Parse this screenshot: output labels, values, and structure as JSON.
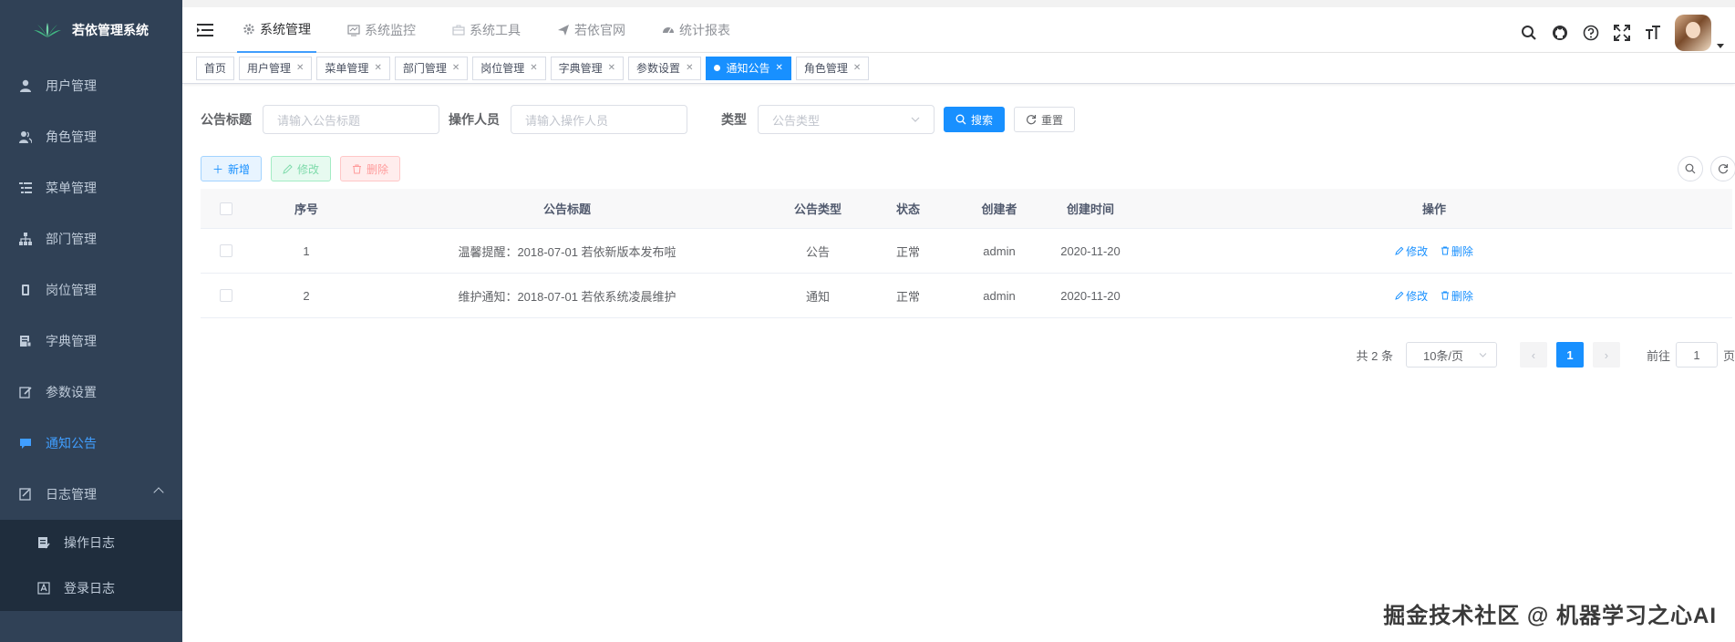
{
  "sidebar": {
    "logo_text": "若依管理系统",
    "items": [
      {
        "label": "用户管理"
      },
      {
        "label": "角色管理"
      },
      {
        "label": "菜单管理"
      },
      {
        "label": "部门管理"
      },
      {
        "label": "岗位管理"
      },
      {
        "label": "字典管理"
      },
      {
        "label": "参数设置"
      },
      {
        "label": "通知公告"
      },
      {
        "label": "日志管理"
      }
    ],
    "sub_items": [
      {
        "label": "操作日志"
      },
      {
        "label": "登录日志"
      }
    ]
  },
  "topnav": [
    {
      "label": "系统管理"
    },
    {
      "label": "系统监控"
    },
    {
      "label": "系统工具"
    },
    {
      "label": "若依官网"
    },
    {
      "label": "统计报表"
    }
  ],
  "tags": [
    {
      "label": "首页"
    },
    {
      "label": "用户管理"
    },
    {
      "label": "菜单管理"
    },
    {
      "label": "部门管理"
    },
    {
      "label": "岗位管理"
    },
    {
      "label": "字典管理"
    },
    {
      "label": "参数设置"
    },
    {
      "label": "通知公告"
    },
    {
      "label": "角色管理"
    }
  ],
  "search": {
    "title_label": "公告标题",
    "title_placeholder": "请输入公告标题",
    "operator_label": "操作人员",
    "operator_placeholder": "请输入操作人员",
    "type_label": "类型",
    "type_placeholder": "公告类型",
    "search_btn": "搜索",
    "reset_btn": "重置"
  },
  "toolbar": {
    "add": "新增",
    "edit": "修改",
    "delete": "删除"
  },
  "table": {
    "headers": [
      "序号",
      "公告标题",
      "公告类型",
      "状态",
      "创建者",
      "创建时间",
      "操作"
    ],
    "rows": [
      {
        "id": "1",
        "title": "温馨提醒：2018-07-01 若依新版本发布啦",
        "type": "公告",
        "status": "正常",
        "creator": "admin",
        "created": "2020-11-20"
      },
      {
        "id": "2",
        "title": "维护通知：2018-07-01 若依系统凌晨维护",
        "type": "通知",
        "status": "正常",
        "creator": "admin",
        "created": "2020-11-20"
      }
    ],
    "op_edit": "修改",
    "op_delete": "删除"
  },
  "pagination": {
    "total": "共 2 条",
    "page_size": "10条/页",
    "current": "1",
    "goto_label": "前往",
    "goto_value": "1",
    "page_suffix": "页"
  },
  "watermark": "掘金技术社区 @ 机器学习之心AI",
  "colors": {
    "sidebar_bg": "#304156",
    "accent": "#1890ff",
    "menu_active": "#409eff"
  }
}
